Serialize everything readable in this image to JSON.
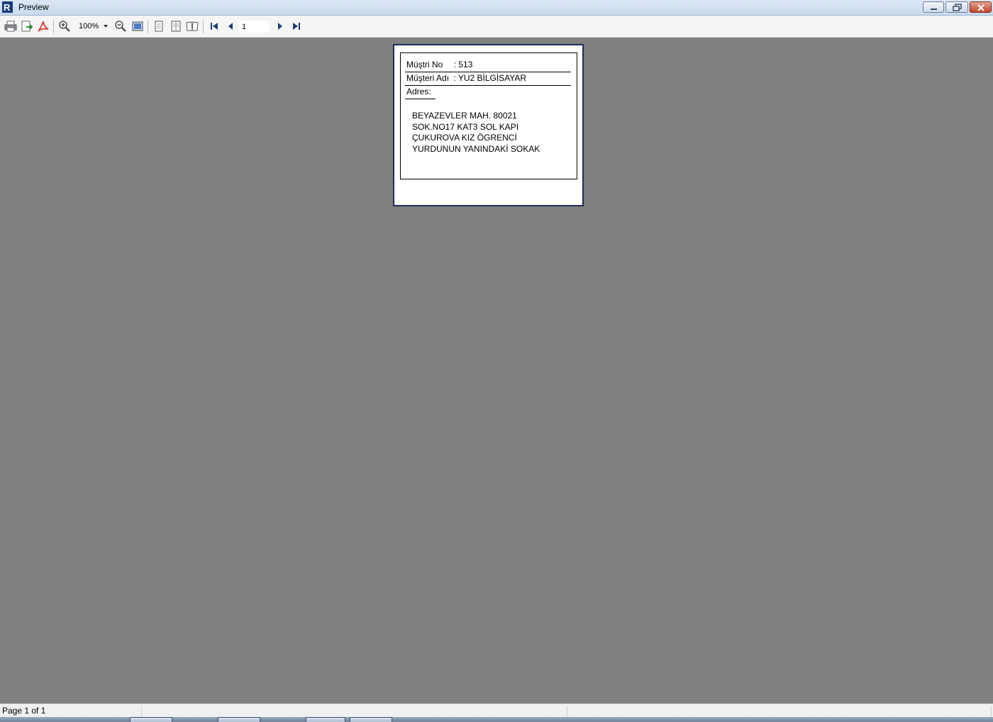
{
  "window": {
    "title": "Preview",
    "minimize_icon": "minimize-icon",
    "maximize_icon": "restore-icon",
    "close_icon": "close-icon"
  },
  "toolbar": {
    "icons": [
      "print-icon",
      "export-icon",
      "pdf-icon",
      "zoom-in-icon",
      "zoom-out-icon",
      "fit-page-icon",
      "single-page-icon",
      "multi-page-icon",
      "book-icon",
      "first-page-icon",
      "previous-page-icon",
      "next-page-icon",
      "last-page-icon"
    ],
    "zoom_value": "100%",
    "page_value": "1"
  },
  "report": {
    "customer_no_label": "Müştri No",
    "customer_no_value": ": 513",
    "customer_name_label": "Müşteri Adı",
    "customer_name_value": ": YU2 BİLGİSAYAR",
    "address_label": "Adres:",
    "address_lines": [
      "BEYAZEVLER MAH. 80021",
      "SOK.NO17 KAT3 SOL KAPI",
      "ÇUKUROVA KIZ ÖGRENCİ",
      "YURDUNUN YANINDAKİ SOKAK"
    ]
  },
  "status": {
    "page_text": "Page 1 of 1"
  },
  "colors": {
    "preview_background": "#808080",
    "page_border": "#1f2d5a",
    "pdf_red": "#d0261c"
  }
}
